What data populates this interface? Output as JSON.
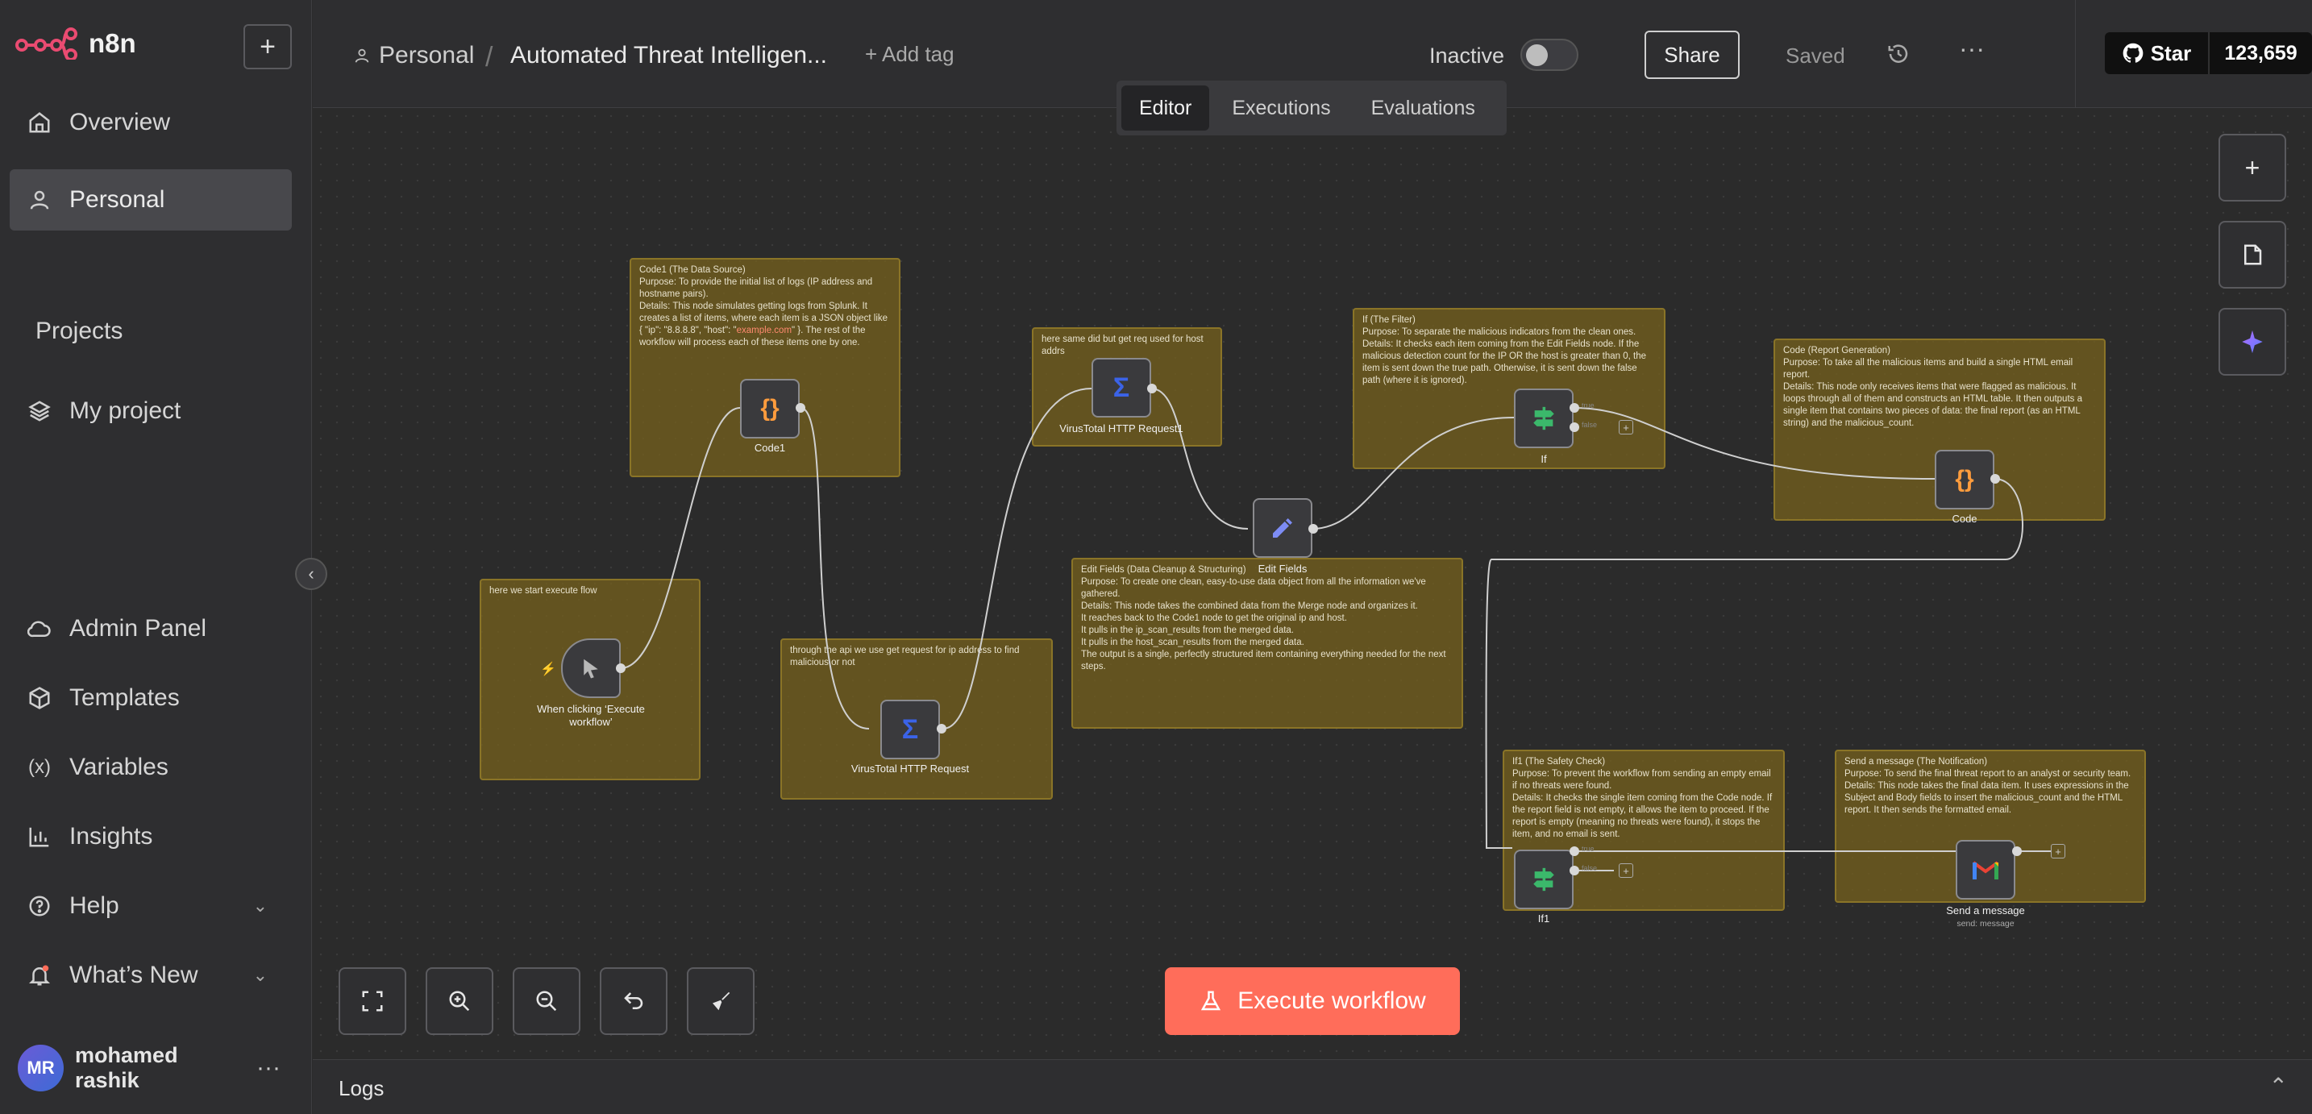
{
  "app": {
    "name": "n8n",
    "new_button": "+"
  },
  "sidebar": {
    "top_items": [
      {
        "label": "Overview",
        "icon": "home-icon"
      },
      {
        "label": "Personal",
        "icon": "user-icon"
      }
    ],
    "projects_title": "Projects",
    "projects": [
      {
        "label": "My project",
        "icon": "layers-icon"
      }
    ],
    "bottom_items": [
      {
        "label": "Admin Panel",
        "icon": "cloud-icon"
      },
      {
        "label": "Templates",
        "icon": "box-icon"
      },
      {
        "label": "Variables",
        "icon": "variable-icon"
      },
      {
        "label": "Insights",
        "icon": "chart-icon"
      },
      {
        "label": "Help",
        "icon": "help-icon"
      },
      {
        "label": "What’s New",
        "icon": "bell-icon"
      }
    ],
    "user": {
      "initials": "MR",
      "name": "mohamed rashik",
      "more": "···"
    },
    "collapse": "‹"
  },
  "header": {
    "owner": "Personal",
    "separator": "/",
    "workflow_title": "Automated Threat Intelligen...",
    "add_tag": "+ Add tag",
    "status_label": "Inactive",
    "share_label": "Share",
    "saved_label": "Saved",
    "more": "···",
    "github_star": "Star",
    "github_count": "123,659"
  },
  "tabs": [
    "Editor",
    "Executions",
    "Evaluations"
  ],
  "notes": {
    "code1": {
      "title": "Code1 (The Data Source)",
      "l1": "Purpose: To provide the initial list of logs (IP address and hostname pairs).",
      "l2a": "Details: This node simulates getting logs from Splunk. It creates a list of items, where each item is a JSON object like { \"ip\": \"8.8.8.8\", \"host\": \"",
      "l2b": "example.com",
      "l2c": "\" }. The rest of the workflow will process each of these items one by one."
    },
    "start": {
      "text": "here we start execute flow"
    },
    "vt": {
      "text": "through the api we use get request for ip address to find malicious or not"
    },
    "vt1": {
      "text": "here same did but get req used for host addrs"
    },
    "edit": {
      "title": "Edit Fields (Data Cleanup & Structuring)",
      "l1": "Purpose: To create one clean, easy-to-use data object from all the information we've gathered.",
      "l2": "Details: This node takes the combined data from the Merge node and organizes it.",
      "l3": "It reaches back to the Code1 node to get the original ip and host.",
      "l4": "It pulls in the ip_scan_results from the merged data.",
      "l5": "It pulls in the host_scan_results from the merged data.",
      "l6": "The output is a single, perfectly structured item containing everything needed for the next steps."
    },
    "if": {
      "title": "If (The Filter)",
      "l1": "Purpose: To separate the malicious indicators from the clean ones.",
      "l2": "Details: It checks each item coming from the Edit Fields node. If the malicious detection count for the IP OR the host is greater than 0, the item is sent down the true path. Otherwise, it is sent down the false path (where it is ignored)."
    },
    "code": {
      "title": "Code (Report Generation)",
      "l1": "Purpose: To take all the malicious items and build a single HTML email report.",
      "l2": "Details: This node only receives items that were flagged as malicious. It loops through all of them and constructs an HTML table. It then outputs a single item that contains two pieces of data: the final report (as an HTML string) and the malicious_count."
    },
    "if1": {
      "title": "If1 (The Safety Check)",
      "l1": "Purpose: To prevent the workflow from sending an empty email if no threats were found.",
      "l2": "Details: It checks the single item coming from the Code node. If the report field is not empty, it allows the item to proceed. If the report is empty (meaning no threats were found), it stops the item, and no email is sent."
    },
    "send": {
      "title": "Send a message (The Notification)",
      "l1": "Purpose: To send the final threat report to an analyst or security team.",
      "l2": "Details: This node takes the final data item. It uses expressions in the Subject and Body fields to insert the malicious_count and the HTML report. It then sends the formatted email."
    }
  },
  "nodes": {
    "trigger": "When clicking ‘Execute workflow’",
    "code1": "Code1",
    "vt": "VirusTotal HTTP Request",
    "vt1": "VirusTotal HTTP Request1",
    "edit": "Edit Fields",
    "if": "If",
    "code": "Code",
    "if1": "If1",
    "send": "Send a message",
    "send_sub": "send: message",
    "true_label": "true",
    "false_label": "false"
  },
  "toolbar": {
    "execute_label": "Execute workflow"
  },
  "logs": {
    "label": "Logs"
  },
  "colors": {
    "accent": "#ff6d5a",
    "note_bg": "#78621c",
    "canvas": "#2b2b2b"
  }
}
